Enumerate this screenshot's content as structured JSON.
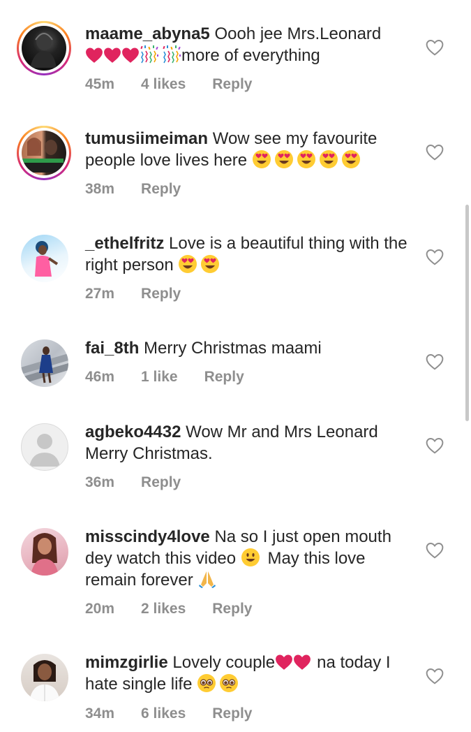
{
  "comments": [
    {
      "username": "maame_abyna5",
      "text_before": "Oooh jee Mrs.Leonard",
      "text_after": "more of everything",
      "time": "45m",
      "likes": "4 likes",
      "reply": "Reply"
    },
    {
      "username": "tumusiimeiman",
      "text": "Wow see my favourite people love lives here",
      "time": "38m",
      "reply": "Reply"
    },
    {
      "username": "_ethelfritz",
      "text": "Love is a beautiful thing with the right person",
      "time": "27m",
      "reply": "Reply"
    },
    {
      "username": "fai_8th",
      "text": "Merry Christmas maami",
      "time": "46m",
      "likes": "1 like",
      "reply": "Reply"
    },
    {
      "username": "agbeko4432",
      "text": "Wow Mr and Mrs Leonard Merry Christmas.",
      "time": "36m",
      "reply": "Reply"
    },
    {
      "username": "misscindy4love",
      "text_before": "Na so I just open mouth dey watch this video",
      "text_after": "May this love remain forever",
      "time": "20m",
      "likes": "2 likes",
      "reply": "Reply"
    },
    {
      "username": "mimzgirlie",
      "text_before": "Lovely couple",
      "text_after": "na today I hate single life",
      "time": "34m",
      "likes": "6 likes",
      "reply": "Reply"
    }
  ],
  "icons": {
    "like": "heart-outline-icon",
    "emoji_heart": "red-heart-emoji",
    "emoji_confetti": "party-popper-emoji",
    "emoji_heart_eyes": "heart-eyes-emoji",
    "emoji_smile": "smiley-emoji",
    "emoji_pray": "folded-hands-emoji",
    "emoji_pleading": "pleading-face-emoji"
  },
  "colors": {
    "text": "#262626",
    "meta": "#8e8e8e",
    "heart_emoji": "#e0245e",
    "story_ring": "#d62976"
  }
}
